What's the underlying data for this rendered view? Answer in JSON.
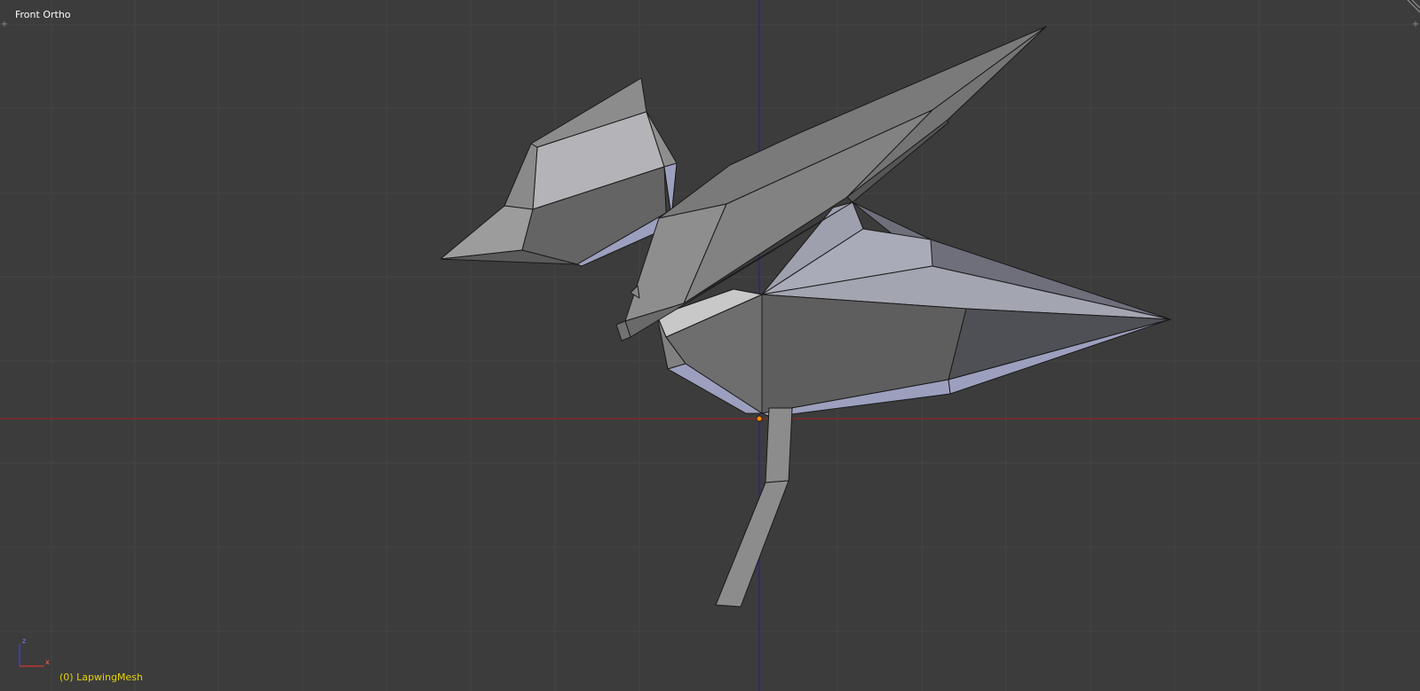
{
  "viewport": {
    "view_name": "Front Ortho",
    "object_label": "(0) LapwingMesh",
    "axis_labels": {
      "z": "z",
      "x": "x"
    },
    "colors": {
      "background": "#3c3c3c",
      "grid": "#444444",
      "x_axis": "#a02020",
      "z_axis": "#2020a0",
      "title_text": "#ffffff",
      "object_text": "#e6d200",
      "origin_dot": "#ff8c00"
    },
    "icons": {
      "corner_left": "plus-icon",
      "corner_right": "plus-icon",
      "corner_split": "area-split-icon"
    }
  }
}
